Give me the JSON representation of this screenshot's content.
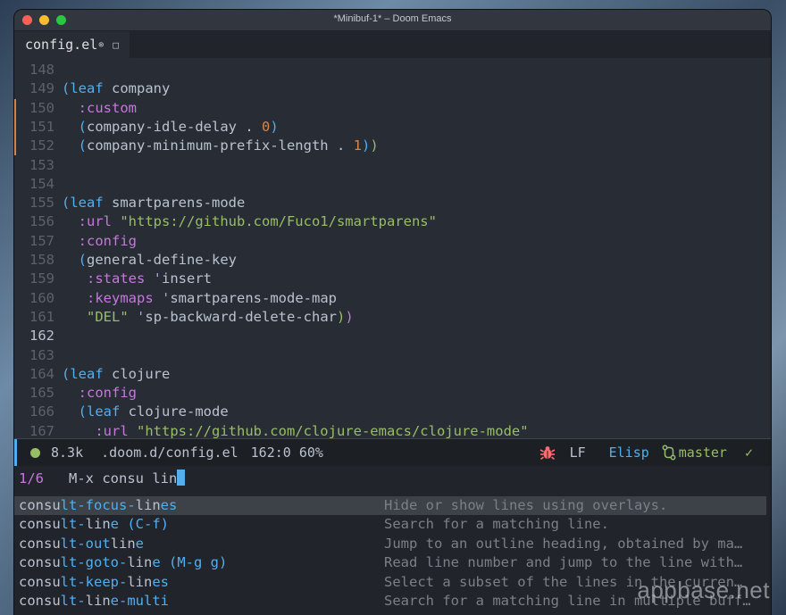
{
  "window": {
    "title": "*Minibuf-1* – Doom Emacs"
  },
  "tab": {
    "name": "config.el",
    "modified_mark": "⊗",
    "extra_icon": "□"
  },
  "editor": {
    "current_line": "162",
    "lines": [
      {
        "num": "148",
        "code": ""
      },
      {
        "num": "149",
        "code": "(leaf company"
      },
      {
        "num": "150",
        "code": "  :custom"
      },
      {
        "num": "151",
        "code": "  (company-idle-delay . 0)"
      },
      {
        "num": "152",
        "code": "  (company-minimum-prefix-length . 1))"
      },
      {
        "num": "153",
        "code": ""
      },
      {
        "num": "154",
        "code": ""
      },
      {
        "num": "155",
        "code": "(leaf smartparens-mode"
      },
      {
        "num": "156",
        "code": "  :url \"https://github.com/Fuco1/smartparens\""
      },
      {
        "num": "157",
        "code": "  :config"
      },
      {
        "num": "158",
        "code": "  (general-define-key"
      },
      {
        "num": "159",
        "code": "   :states 'insert"
      },
      {
        "num": "160",
        "code": "   :keymaps 'smartparens-mode-map"
      },
      {
        "num": "161",
        "code": "   \"DEL\" 'sp-backward-delete-char))"
      },
      {
        "num": "162",
        "code": ""
      },
      {
        "num": "163",
        "code": ""
      },
      {
        "num": "164",
        "code": "(leaf clojure"
      },
      {
        "num": "165",
        "code": "  :config"
      },
      {
        "num": "166",
        "code": "  (leaf clojure-mode"
      },
      {
        "num": "167",
        "code": "    :url \"https://github.com/clojure-emacs/clojure-mode\""
      }
    ]
  },
  "modeline": {
    "size": "8.3k",
    "file": ".doom.d/config.el",
    "position": "162:0 60%",
    "eol": "LF",
    "mode": "Elisp",
    "branch": "master",
    "check": "✓",
    "colors": {
      "accent": "#51afef",
      "success": "#98be65",
      "error": "#ff6c6b"
    }
  },
  "minibuffer": {
    "count": "1/6",
    "prompt": "M-x",
    "input": "consu lin",
    "candidates": [
      {
        "name": "consult-focus-lines",
        "key": "",
        "desc": "Hide or show lines using overlays."
      },
      {
        "name": "consult-line",
        "key": "(C-f)",
        "desc": "Search for a matching line."
      },
      {
        "name": "consult-outline",
        "key": "",
        "desc": "Jump to an outline heading, obtained by ma…"
      },
      {
        "name": "consult-goto-line",
        "key": "(M-g g)",
        "desc": "Read line number and jump to the line with…"
      },
      {
        "name": "consult-keep-lines",
        "key": "",
        "desc": "Select a subset of the lines in the curren…"
      },
      {
        "name": "consult-line-multi",
        "key": "",
        "desc": "Search for a matching line in multiple buff…"
      }
    ]
  },
  "watermark": "appbase.net"
}
